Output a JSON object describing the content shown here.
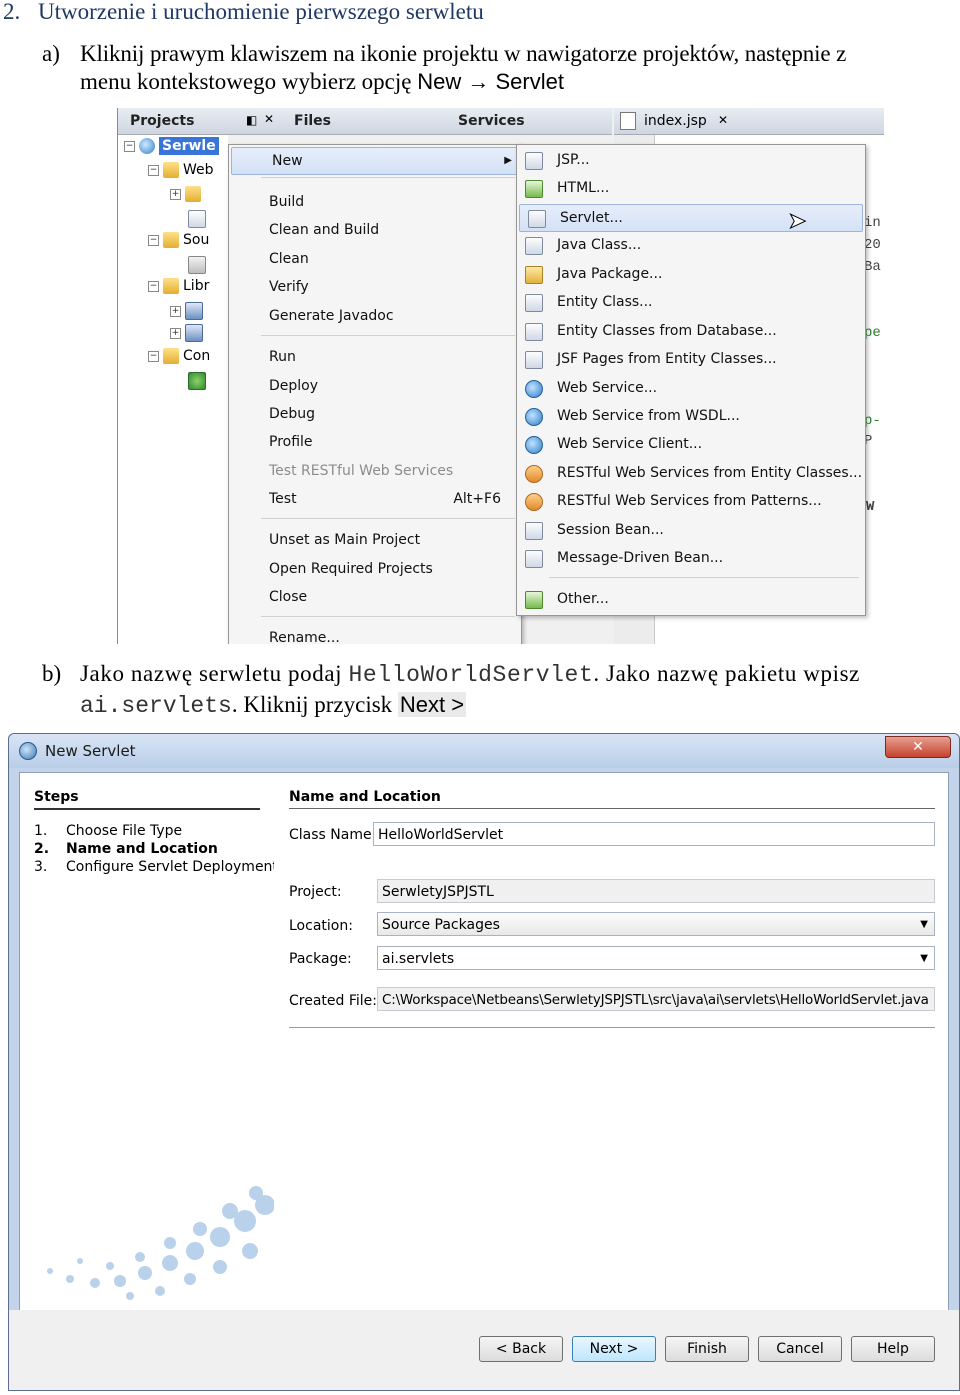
{
  "doc": {
    "step2_num": "2.",
    "step2_text": "Utworzenie i uruchomienie pierwszego serwletu",
    "a_marker": "a)",
    "a_line1": "Kliknij prawym klawiszem na ikonie projektu w nawigatorze projektów, następnie z",
    "a_line2_prefix": "menu kontekstowego wybierz opcję ",
    "a_line2_option": "New → Servlet",
    "b_marker": "b)",
    "b_line1_prefix": "Jako nazwę serwletu podaj ",
    "b_class_name": "HelloWorldServlet",
    "b_line1_mid": ". Jako nazwę pakietu wpisz",
    "b_package": "ai.servlets",
    "b_line2_mid": ". Kliknij przycisk ",
    "b_button": "Next >"
  },
  "ide": {
    "tabs": {
      "projects": "Projects",
      "files": "Files",
      "services": "Services",
      "editor": "index.jsp"
    },
    "tree": [
      {
        "label": "Serwle",
        "box": "−"
      },
      {
        "label": "Web",
        "box": "−"
      },
      {
        "label": "",
        "box": "+"
      },
      {
        "label": "",
        "box": ""
      },
      {
        "label": "Sou",
        "box": "−"
      },
      {
        "label": "",
        "box": ""
      },
      {
        "label": "Libr",
        "box": "−"
      },
      {
        "label": "",
        "box": "+"
      },
      {
        "label": "",
        "box": "+"
      },
      {
        "label": "Con",
        "box": "−"
      },
      {
        "label": "",
        "box": ""
      }
    ],
    "context_menu": {
      "new": "New",
      "group1": [
        "Build",
        "Clean and Build",
        "Clean",
        "Verify",
        "Generate Javadoc"
      ],
      "group2": [
        "Run",
        "Deploy",
        "Debug",
        "Profile",
        "Test RESTful Web Services",
        "Test"
      ],
      "test_shortcut": "Alt+F6",
      "group3": [
        "Unset as Main Project",
        "Open Required Projects",
        "Close"
      ],
      "rename": "Rename..."
    },
    "submenu": [
      "JSP...",
      "HTML...",
      "Servlet...",
      "Java Class...",
      "Java Package...",
      "Entity Class...",
      "Entity Classes from Database...",
      "JSF Pages from Entity Classes...",
      "Web Service...",
      "Web Service from WSDL...",
      "Web Service Client...",
      "RESTful Web Services from Entity Classes...",
      "RESTful Web Services from Patterns...",
      "Session Bean...",
      "Message-Driven Bean..."
    ],
    "submenu_other": "Other...",
    "editor_fragments": [
      "in",
      "20",
      "Ba",
      "pe",
      "p-",
      "P",
      "W"
    ]
  },
  "dialog": {
    "title": "New Servlet",
    "close": "✕",
    "steps_heading": "Steps",
    "steps": [
      {
        "num": "1.",
        "label": "Choose File Type"
      },
      {
        "num": "2.",
        "label": "Name and Location"
      },
      {
        "num": "3.",
        "label": "Configure Servlet Deployment"
      }
    ],
    "section_heading": "Name and Location",
    "class_name_label": "Class Name:",
    "class_name_value": "HelloWorldServlet",
    "project_label": "Project:",
    "project_value": "SerwletyJSPJSTL",
    "location_label": "Location:",
    "location_value": "Source Packages",
    "package_label": "Package:",
    "package_value": "ai.servlets",
    "created_file_label": "Created File:",
    "created_file_value": "C:\\Workspace\\Netbeans\\SerwletyJSPJSTL\\src\\java\\ai\\servlets\\HelloWorldServlet.java",
    "buttons": {
      "back": "< Back",
      "next": "Next >",
      "finish": "Finish",
      "cancel": "Cancel",
      "help": "Help"
    }
  }
}
